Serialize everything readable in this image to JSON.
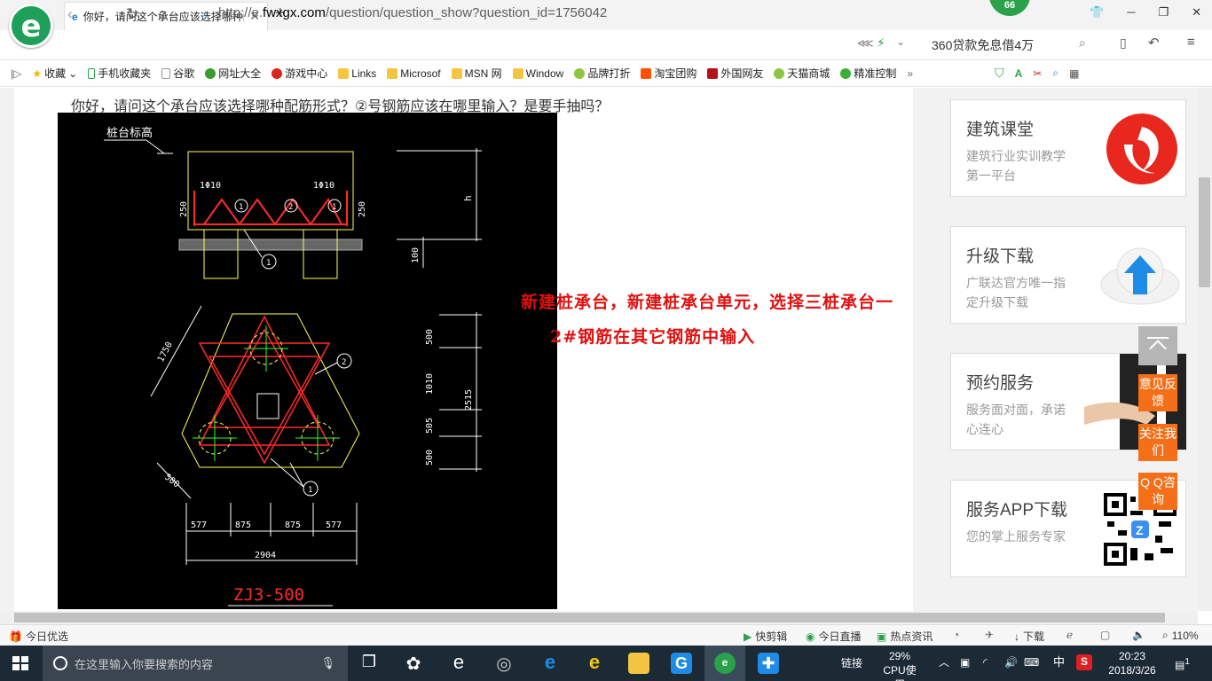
{
  "browser": {
    "tab_title": "你好，请问这个承台应该选择哪种配筋形式",
    "badge": "66",
    "url_prefix": "http://e.",
    "url_domain": "fwxgx.com",
    "url_path": "/question/question_show?question_id=1756042",
    "news_ticker": "360贷款免息借4万"
  },
  "bookmarks": [
    "收藏",
    "手机收藏夹",
    "谷歌",
    "网址大全",
    "游戏中心",
    "Links",
    "Microsof",
    "MSN 网",
    "Window",
    "品牌打折",
    "淘宝团购",
    "外国网友",
    "天猫商城",
    "精准控制"
  ],
  "question": {
    "title": "你好，请问这个承台应该选择哪种配筋形式？②号钢筋应该在哪里输入？是要手抽吗？"
  },
  "cad": {
    "label_top": "桩台标高",
    "bar1": "1Φ10",
    "bar2": "1Φ10",
    "dim_h": "h",
    "dim_250a": "250",
    "dim_250b": "250",
    "dim_100": "100",
    "dim_1750": "1750",
    "dim_500a": "500",
    "dim_1010": "1010",
    "dim_505": "505",
    "dim_500b": "500",
    "dim_2515": "2515",
    "dim_500c": "500",
    "dim_577a": "577",
    "dim_875a": "875",
    "dim_875b": "875",
    "dim_577b": "577",
    "dim_2904": "2904",
    "caption": "ZJ3-500",
    "c1": "1",
    "c2": "2",
    "c3": "1",
    "c4": "1",
    "c5": "2",
    "c6": "1"
  },
  "annotation": {
    "line1": "新建桩承台，新建桩承台单元，选择三桩承台一",
    "line2": "2#钢筋在其它钢筋中输入"
  },
  "sidebar": [
    {
      "title": "建筑课堂",
      "desc": "建筑行业实训教学第一平台"
    },
    {
      "title": "升级下载",
      "desc": "广联达官方唯一指定升级下载"
    },
    {
      "title": "预约服务",
      "desc": "服务面对面，承诺心连心"
    },
    {
      "title": "服务APP下载",
      "desc": "您的掌上服务专家"
    }
  ],
  "float_tools": {
    "feedback": "意见反馈",
    "follow": "关注我们",
    "qq": "Q Q咨询"
  },
  "statusbar": {
    "left": "今日优选",
    "kuaijian": "快剪辑",
    "live": "今日直播",
    "news": "热点资讯",
    "download": "下载",
    "zoom": "110%"
  },
  "taskbar": {
    "search_placeholder": "在这里输入你要搜索的内容",
    "network": "链接",
    "cpu_pct": "29%",
    "cpu_label": "CPU使用",
    "ime": "中",
    "time": "20:23",
    "date": "2018/3/26",
    "notif": "1"
  }
}
